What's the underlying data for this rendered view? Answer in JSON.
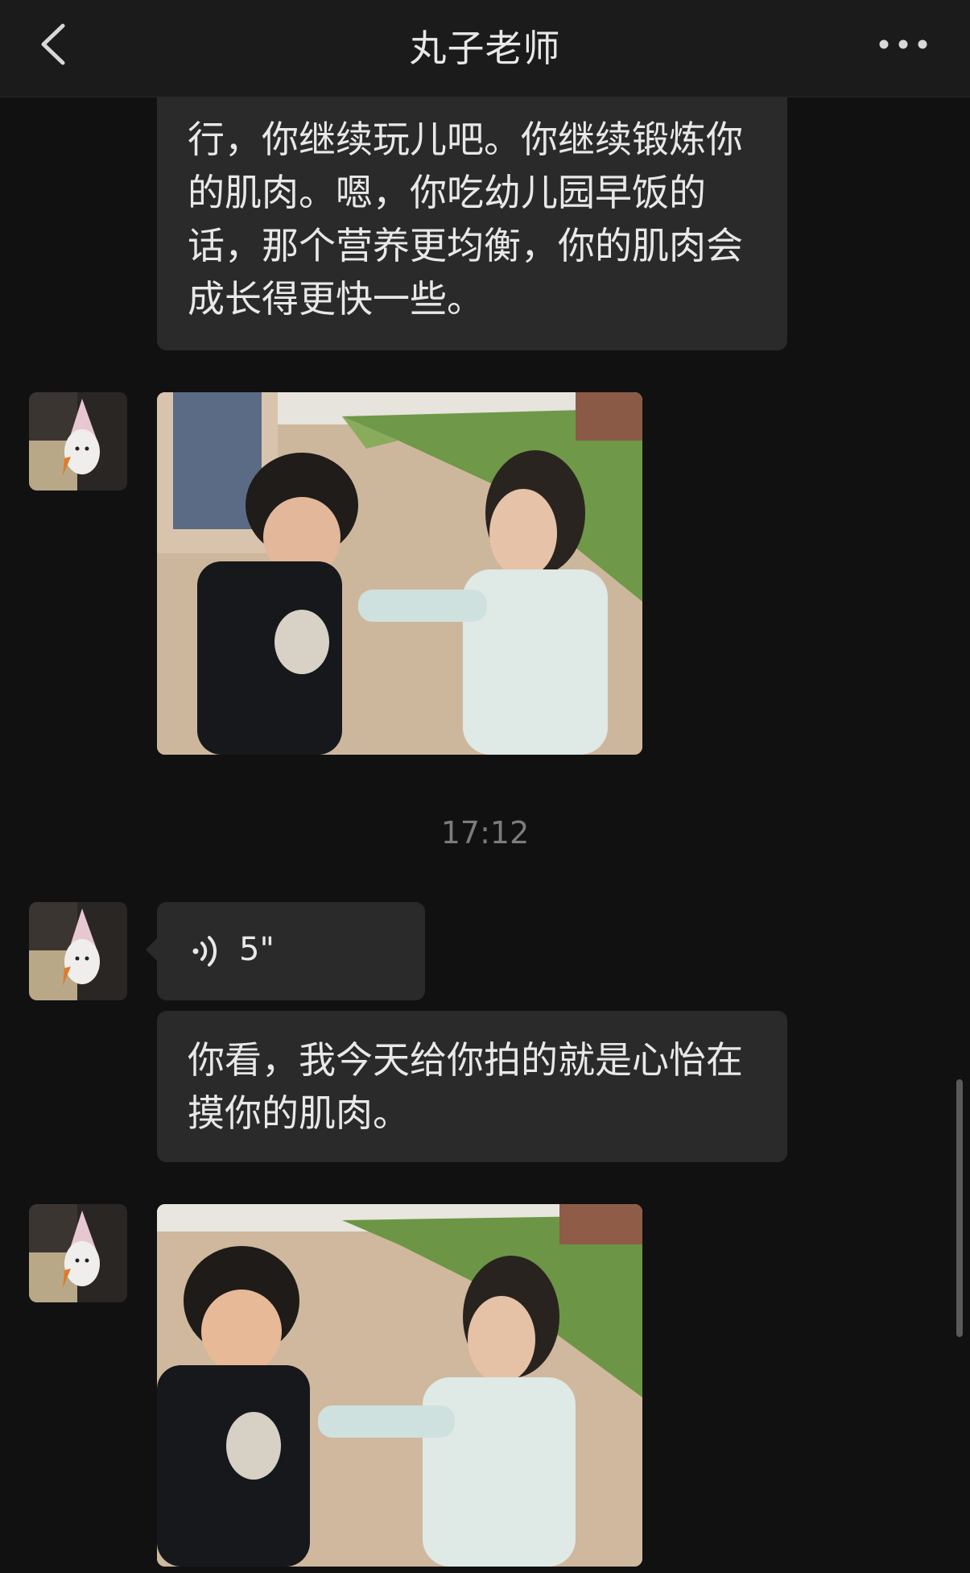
{
  "header": {
    "title": "丸子老师",
    "back_icon": "chevron-left-icon",
    "more_icon": "more-dots-icon"
  },
  "messages": [
    {
      "type": "text",
      "text": "行，你继续玩儿吧。你继续锻炼你的肌肉。嗯，你吃幼儿园早饭的话，那个营养更均衡，你的肌肉会成长得更快一些。"
    },
    {
      "type": "image",
      "description": ""
    },
    {
      "type": "timestamp",
      "text": "17:12"
    },
    {
      "type": "voice",
      "duration": "5\"",
      "icon": "voice-waves-icon"
    },
    {
      "type": "text",
      "text": "你看，我今天给你拍的就是心怡在摸你的肌肉。"
    },
    {
      "type": "image",
      "description": ""
    }
  ],
  "colors": {
    "background": "#111111",
    "bubble": "#2a2a2a",
    "header": "#1b1b1b",
    "text": "#e8e8e8",
    "timestamp": "#7c7c7c"
  }
}
